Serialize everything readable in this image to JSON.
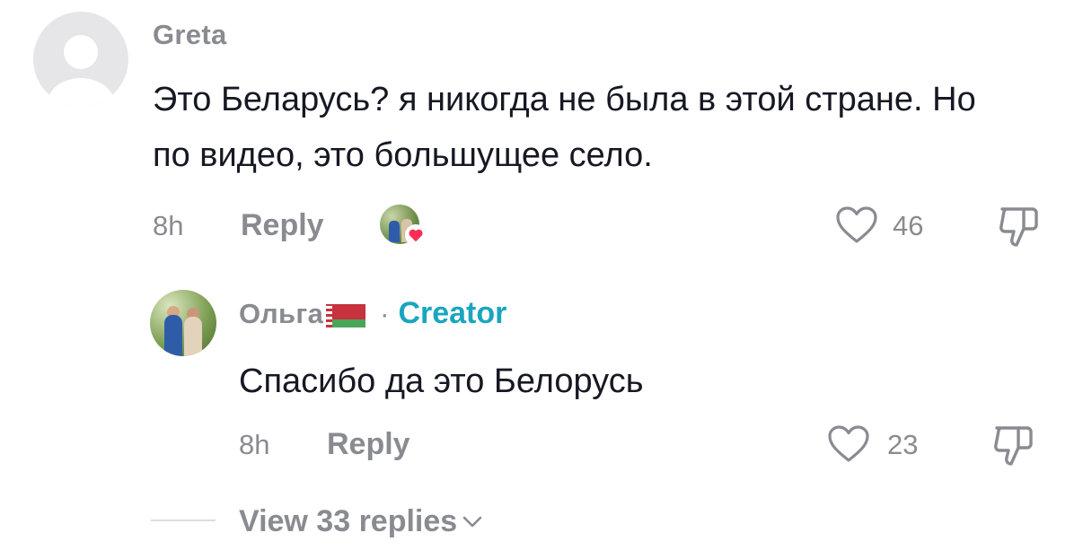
{
  "comment": {
    "username": "Greta",
    "text": "Это Беларусь? я никогда не была в этой стране. Но по видео, это большущее село.",
    "time": "8h",
    "reply_label": "Reply",
    "like_count": "46"
  },
  "reply": {
    "username": "Ольга",
    "badge_sep": "·",
    "creator_label": "Creator",
    "text": "Спасибо да это Белорусь",
    "time": "8h",
    "reply_label": "Reply",
    "like_count": "23"
  },
  "view_replies_label": "View 33 replies",
  "colors": {
    "text_primary": "#161823",
    "text_secondary": "#8a8b91",
    "creator": "#1aa5bf",
    "heart_badge": "#fe2c55"
  },
  "icons": {
    "default_avatar": "person-icon",
    "like": "heart-outline-icon",
    "dislike": "thumbs-down-icon",
    "liked_by_creator": "heart-filled-icon",
    "expand": "chevron-down-icon"
  }
}
